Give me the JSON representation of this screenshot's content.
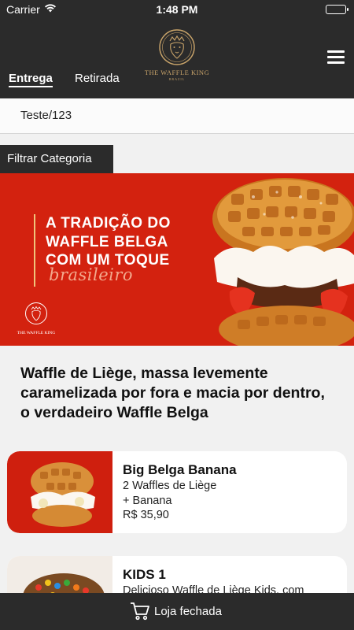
{
  "status_bar": {
    "carrier": "Carrier",
    "time": "1:48 PM"
  },
  "header": {
    "tabs": [
      {
        "label": "Entrega",
        "active": true
      },
      {
        "label": "Retirada",
        "active": false
      }
    ],
    "logo_text": "THE WAFFLE KING",
    "logo_subtext": "BRAZIL",
    "menu_icon": "hamburger-menu-icon"
  },
  "address": {
    "value": "Teste/123"
  },
  "filter": {
    "label": "Filtrar Categoria"
  },
  "banner": {
    "line1": "A TRADIÇÃO DO",
    "line2": "WAFFLE BELGA",
    "line3": "COM UM TOQUE",
    "line4": "brasileiro",
    "logo_text": "THE WAFFLE KING",
    "background_color": "#d3220f"
  },
  "category": {
    "headline": "Waffle de Liège, massa levemente caramelizada por fora e macia por dentro, o verdadeiro Waffle Belga"
  },
  "products": [
    {
      "title": "Big Belga Banana",
      "desc_line1": "2 Waffles de Liège",
      "desc_line2": "+ Banana",
      "price": "R$ 35,90"
    },
    {
      "title": "KIDS 1",
      "desc_line1": "Delicioso Waffle de Liège Kids, com",
      "desc_line2": "",
      "price": ""
    }
  ],
  "bottom_bar": {
    "label": "Loja fechada",
    "icon": "cart-icon"
  },
  "colors": {
    "dark": "#2b2b2b",
    "brand_gold": "#c9a46a",
    "banner_red": "#d3220f"
  }
}
